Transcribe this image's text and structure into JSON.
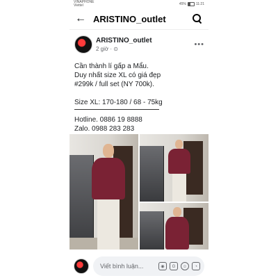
{
  "status_bar": {
    "carrier": "VINAPHONE",
    "carrier2": "Viettel",
    "battery": "45%",
    "time": "11:21"
  },
  "app_bar": {
    "title": "ARISTINO_outlet"
  },
  "post": {
    "author": "ARISTINO_outlet",
    "time": "2 giờ · ⊙",
    "lines": [
      "Cần thành lí gấp a Mẩu.",
      "Duy nhất size XL có giá đẹp",
      "#299k / full set (NY 700k).",
      "Size XL: 170-180 / 68 - 75kg",
      "Hotline. 0886 19 8888",
      "Zalo. 0988 283 283"
    ]
  },
  "comment": {
    "placeholder": "Viết bình luận..."
  },
  "icons": [
    "back-arrow-icon",
    "search-icon",
    "more-icon",
    "camera-icon",
    "gif-icon",
    "emoji-icon",
    "sticker-icon"
  ]
}
